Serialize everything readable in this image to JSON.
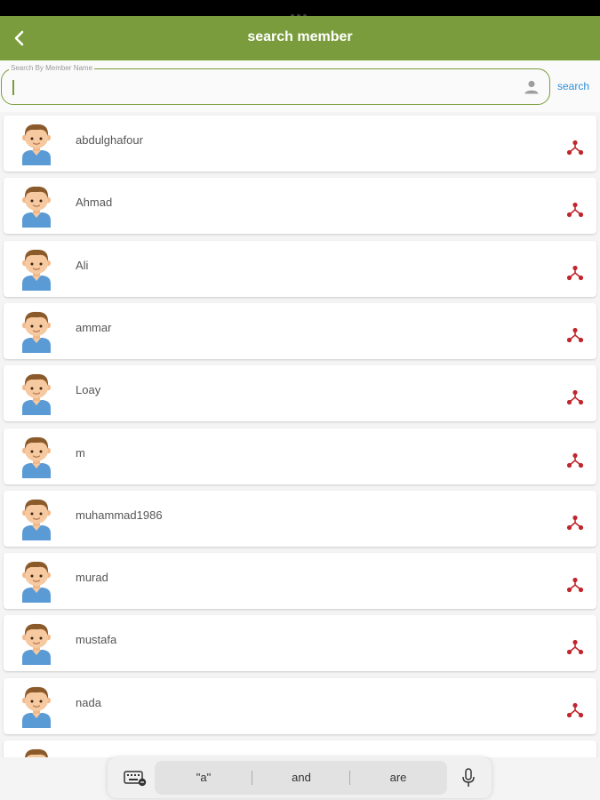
{
  "header": {
    "title": "search member",
    "back_icon": "chevron-left-icon"
  },
  "search": {
    "label": "Search By Member Name",
    "value": "",
    "placeholder": "",
    "trailing_icon": "person-icon",
    "action_label": "search"
  },
  "members": [
    {
      "name": "abdulghafour"
    },
    {
      "name": "Ahmad"
    },
    {
      "name": "Ali"
    },
    {
      "name": "ammar"
    },
    {
      "name": "Loay"
    },
    {
      "name": "m"
    },
    {
      "name": "muhammad1986"
    },
    {
      "name": "murad"
    },
    {
      "name": "mustafa"
    },
    {
      "name": "nada"
    },
    {
      "name": ""
    }
  ],
  "keyboard": {
    "suggestions": [
      "\"a\"",
      "and",
      "are"
    ],
    "left_icon": "keyboard-icon",
    "right_icon": "microphone-icon"
  },
  "colors": {
    "appbar": "#7a9c3c",
    "link": "#2f8fd6",
    "tree_icon": "#c0272d"
  }
}
